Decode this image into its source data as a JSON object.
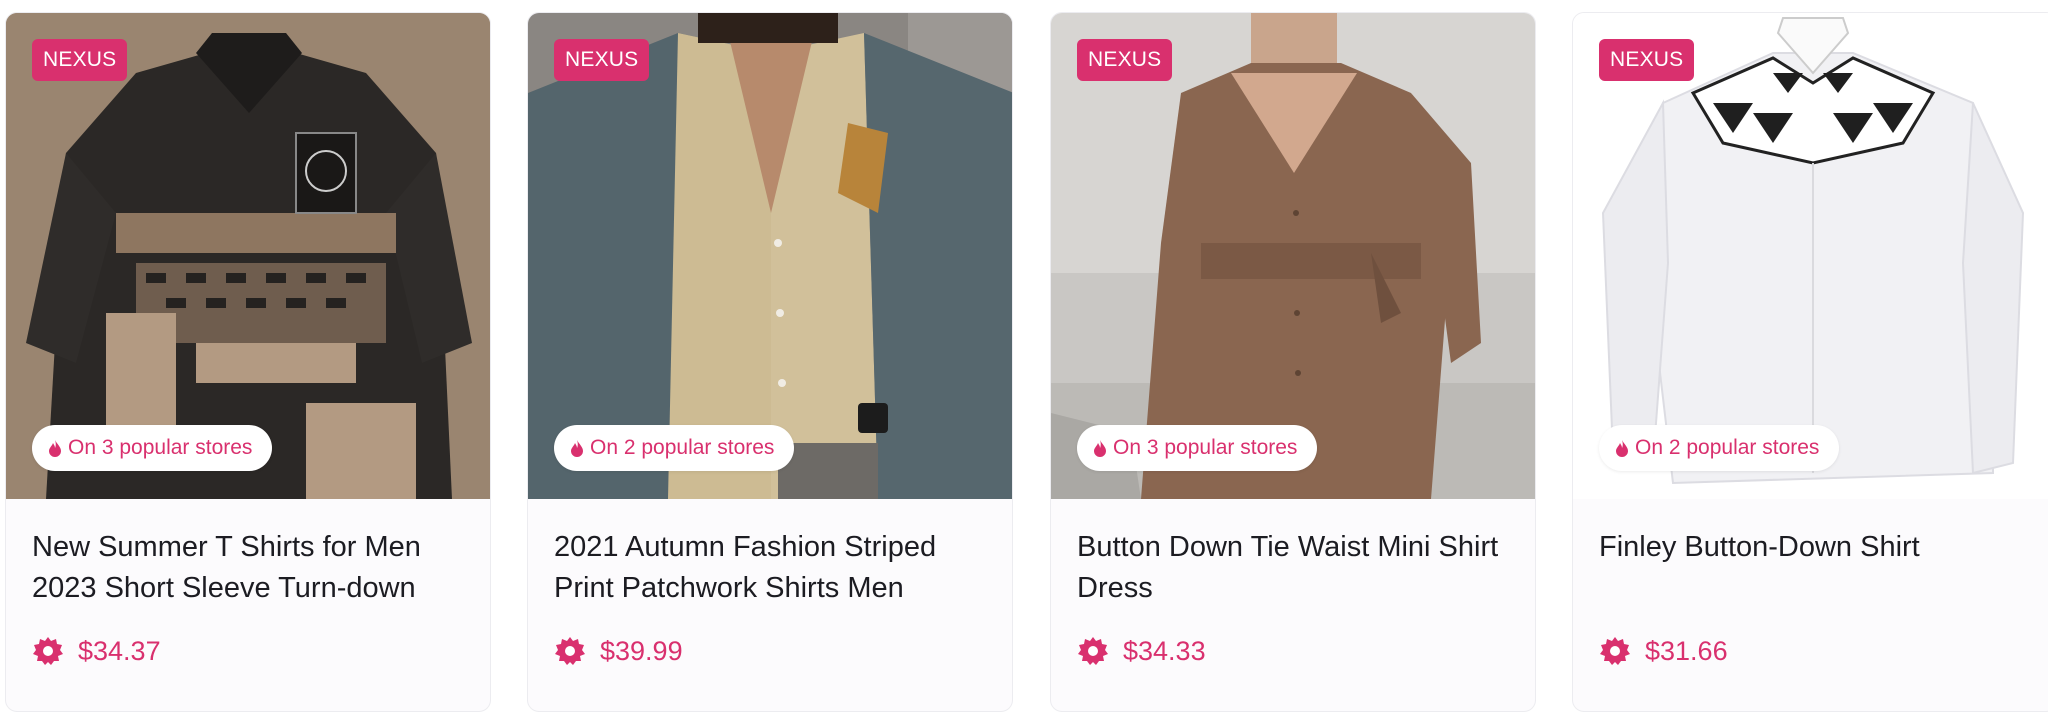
{
  "accent": "#d9306e",
  "products": [
    {
      "brand": "NEXUS",
      "stores": "On 3 popular stores",
      "title": "New Summer T Shirts for Men 2023 Short Sleeve Turn-down",
      "price": "$34.37",
      "image": "men-polo-shirt-photo"
    },
    {
      "brand": "NEXUS",
      "stores": "On 2 popular stores",
      "title": "2021 Autumn Fashion Striped Print Patchwork Shirts Men",
      "price": "$39.99",
      "image": "men-striped-shirt-photo"
    },
    {
      "brand": "NEXUS",
      "stores": "On 3 popular stores",
      "title": "Button Down Tie Waist Mini Shirt Dress",
      "price": "$34.33",
      "image": "brown-shirt-dress-photo"
    },
    {
      "brand": "NEXUS",
      "stores": "On 2 popular stores",
      "title": "Finley Button-Down Shirt",
      "price": "$31.66",
      "image": "white-shirt-photo"
    }
  ],
  "icons": {
    "stores": "flame-icon",
    "price": "gear-badge-icon"
  }
}
